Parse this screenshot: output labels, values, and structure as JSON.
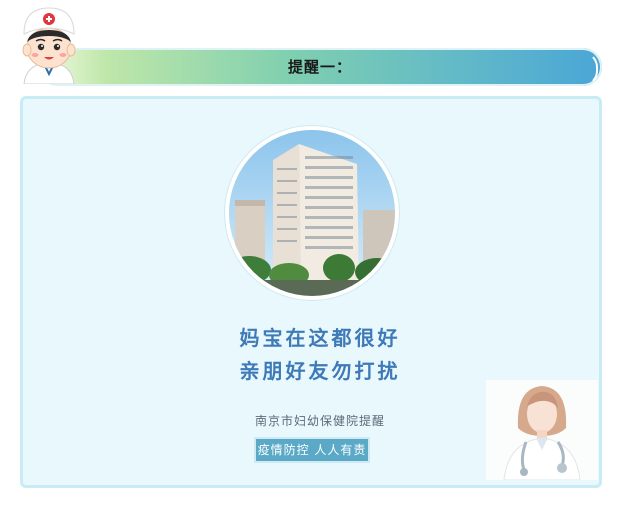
{
  "header": {
    "title": "提醒一："
  },
  "card": {
    "slogan_line1": "妈宝在这都很好",
    "slogan_line2": "亲朋好友勿打扰",
    "organization": "南京市妇幼保健院提醒",
    "badge": "疫情防控 人人有责"
  },
  "colors": {
    "accent": "#3f7ab8",
    "card_bg": "#e8f8fc",
    "badge_bg": "#5aa9c7"
  }
}
